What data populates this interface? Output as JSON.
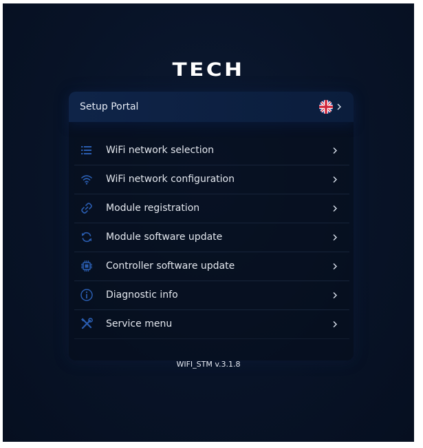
{
  "brand": {
    "logo_text": "TECH"
  },
  "header": {
    "title": "Setup Portal",
    "language_icon": "uk-flag-icon"
  },
  "menu": {
    "items": [
      {
        "label": "WiFi network selection",
        "icon": "list-icon"
      },
      {
        "label": "WiFi network configuration",
        "icon": "wifi-icon"
      },
      {
        "label": "Module registration",
        "icon": "link-icon"
      },
      {
        "label": "Module software update",
        "icon": "refresh-icon"
      },
      {
        "label": "Controller software update",
        "icon": "chip-icon"
      },
      {
        "label": "Diagnostic info",
        "icon": "info-icon"
      },
      {
        "label": "Service menu",
        "icon": "tools-icon"
      }
    ]
  },
  "footer": {
    "version": "WIFI_STM v.3.1.8"
  },
  "colors": {
    "background": "#081327",
    "header": "#0f2448",
    "icon_blue": "#2a5db0",
    "text": "#e4e8ef"
  }
}
